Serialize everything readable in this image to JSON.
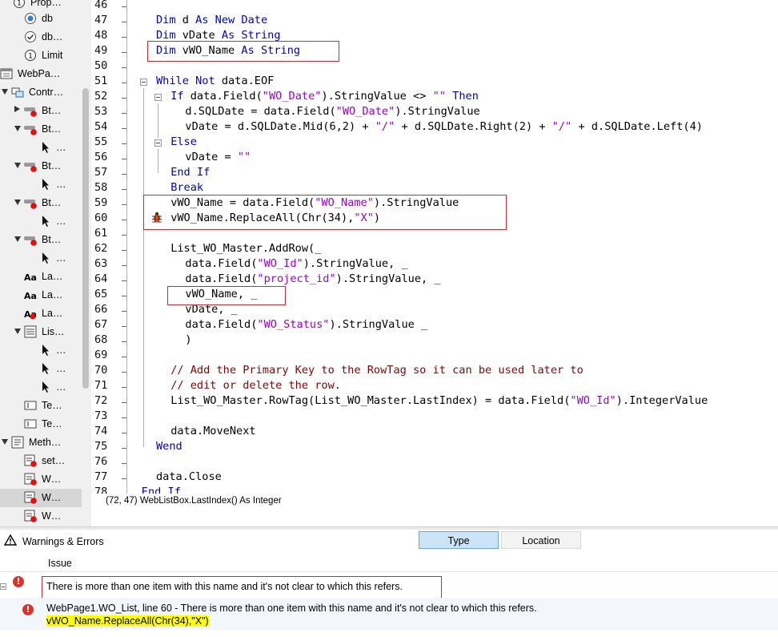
{
  "sidebar": {
    "items": [
      {
        "label": "Prop…"
      },
      {
        "label": "db"
      },
      {
        "label": "db…"
      },
      {
        "label": "Limit"
      },
      {
        "label": "WebPa…"
      },
      {
        "label": "Contr…"
      },
      {
        "label": "Bt…"
      },
      {
        "label": "Bt…"
      },
      {
        "label": "…"
      },
      {
        "label": "Bt…"
      },
      {
        "label": "…"
      },
      {
        "label": "Bt…"
      },
      {
        "label": "…"
      },
      {
        "label": "Bt…"
      },
      {
        "label": "…"
      },
      {
        "label": "La…"
      },
      {
        "label": "La…"
      },
      {
        "label": "La…"
      },
      {
        "label": "Lis…"
      },
      {
        "label": "…"
      },
      {
        "label": "…"
      },
      {
        "label": "…"
      },
      {
        "label": "Te…"
      },
      {
        "label": "Te…"
      },
      {
        "label": "Meth…"
      },
      {
        "label": "set…"
      },
      {
        "label": "W…"
      },
      {
        "label": "W…"
      },
      {
        "label": "W…"
      }
    ]
  },
  "editor": {
    "line_numbers": [
      "46",
      "47",
      "48",
      "49",
      "50",
      "51",
      "52",
      "53",
      "54",
      "55",
      "56",
      "57",
      "58",
      "59",
      "60",
      "61",
      "62",
      "63",
      "64",
      "65",
      "66",
      "67",
      "68",
      "69",
      "70",
      "71",
      "72",
      "73",
      "74",
      "75",
      "76",
      "77",
      "78"
    ],
    "lines": [
      [],
      [
        {
          "t": "Dim ",
          "c": "kw"
        },
        {
          "t": "d "
        },
        {
          "t": "As New ",
          "c": "kw"
        },
        {
          "t": "Date",
          "c": "kw"
        }
      ],
      [
        {
          "t": "Dim ",
          "c": "kw"
        },
        {
          "t": "vDate "
        },
        {
          "t": "As String",
          "c": "kw"
        }
      ],
      [
        {
          "t": "Dim ",
          "c": "kw"
        },
        {
          "t": "vWO_Name "
        },
        {
          "t": "As String",
          "c": "kw"
        }
      ],
      [],
      [
        {
          "t": "While Not ",
          "c": "kw"
        },
        {
          "t": "data.EOF"
        }
      ],
      [
        {
          "t": "If ",
          "c": "kw"
        },
        {
          "t": "data.Field("
        },
        {
          "t": "\"WO_Date\"",
          "c": "str"
        },
        {
          "t": ").StringValue <> "
        },
        {
          "t": "\"\"",
          "c": "str"
        },
        {
          "t": " Then",
          "c": "kw"
        }
      ],
      [
        {
          "t": "d.SQLDate = data.Field("
        },
        {
          "t": "\"WO_Date\"",
          "c": "str"
        },
        {
          "t": ").StringValue"
        }
      ],
      [
        {
          "t": "vDate = d.SQLDate.Mid(6,2) + "
        },
        {
          "t": "\"/\"",
          "c": "str"
        },
        {
          "t": " + d.SQLDate.Right(2) + "
        },
        {
          "t": "\"/\"",
          "c": "str"
        },
        {
          "t": " + d.SQLDate.Left(4)"
        }
      ],
      [
        {
          "t": "Else",
          "c": "kw"
        }
      ],
      [
        {
          "t": "vDate = "
        },
        {
          "t": "\"\"",
          "c": "str"
        }
      ],
      [
        {
          "t": "End If",
          "c": "kw"
        }
      ],
      [
        {
          "t": "Break",
          "c": "kw"
        }
      ],
      [
        {
          "t": "vWO_Name = data.Field("
        },
        {
          "t": "\"WO_Name\"",
          "c": "str"
        },
        {
          "t": ").StringValue"
        }
      ],
      [
        {
          "t": "vWO_Name.ReplaceAll(Chr(34),"
        },
        {
          "t": "\"X\"",
          "c": "str"
        },
        {
          "t": ")"
        }
      ],
      [],
      [
        {
          "t": "List_WO_Master.AddRow(_"
        }
      ],
      [
        {
          "t": "data.Field("
        },
        {
          "t": "\"WO_Id\"",
          "c": "str"
        },
        {
          "t": ").StringValue, _"
        }
      ],
      [
        {
          "t": "data.Field("
        },
        {
          "t": "\"project_id\"",
          "c": "str"
        },
        {
          "t": ").StringValue, _"
        }
      ],
      [
        {
          "t": "vWO_Name, _"
        }
      ],
      [
        {
          "t": "vDate, _"
        }
      ],
      [
        {
          "t": "data.Field("
        },
        {
          "t": "\"WO_Status\"",
          "c": "str"
        },
        {
          "t": ").StringValue _"
        }
      ],
      [
        {
          "t": ")"
        }
      ],
      [],
      [
        {
          "t": "// Add the Primary Key to the RowTag so it can be used later to",
          "c": "cm"
        }
      ],
      [
        {
          "t": "// edit or delete the row.",
          "c": "cm"
        }
      ],
      [
        {
          "t": "List_WO_Master.RowTag(List_WO_Master.LastIndex) = data.Field("
        },
        {
          "t": "\"WO_Id\"",
          "c": "str"
        },
        {
          "t": ").IntegerValue"
        }
      ],
      [],
      [
        {
          "t": "data.MoveNext"
        }
      ],
      [
        {
          "t": "Wend",
          "c": "kw"
        }
      ],
      [],
      [
        {
          "t": "data.Close"
        }
      ],
      [
        {
          "t": "End If",
          "c": "kw"
        }
      ]
    ]
  },
  "status_bar": {
    "text": "(72, 47) WebListBox.LastIndex() As Integer"
  },
  "panel": {
    "title": "Warnings & Errors",
    "tabs": [
      "Type",
      "Location"
    ],
    "column_header": "Issue",
    "issue_group": "There is more than one item with this name and it's not clear to which this refers.",
    "issue_detail": "WebPage1.WO_List, line 60 - There is more than one item with this name and it's not clear to which this refers.",
    "issue_code": "vWO_Name.ReplaceAll(Chr(34),\"X\")"
  },
  "colors": {
    "keyword": "#0000cc",
    "string": "#9b00d4",
    "comment": "#8b0000",
    "highlight_box": "#d9262c",
    "error": "#d9342b",
    "code_highlight": "#ffff00"
  }
}
